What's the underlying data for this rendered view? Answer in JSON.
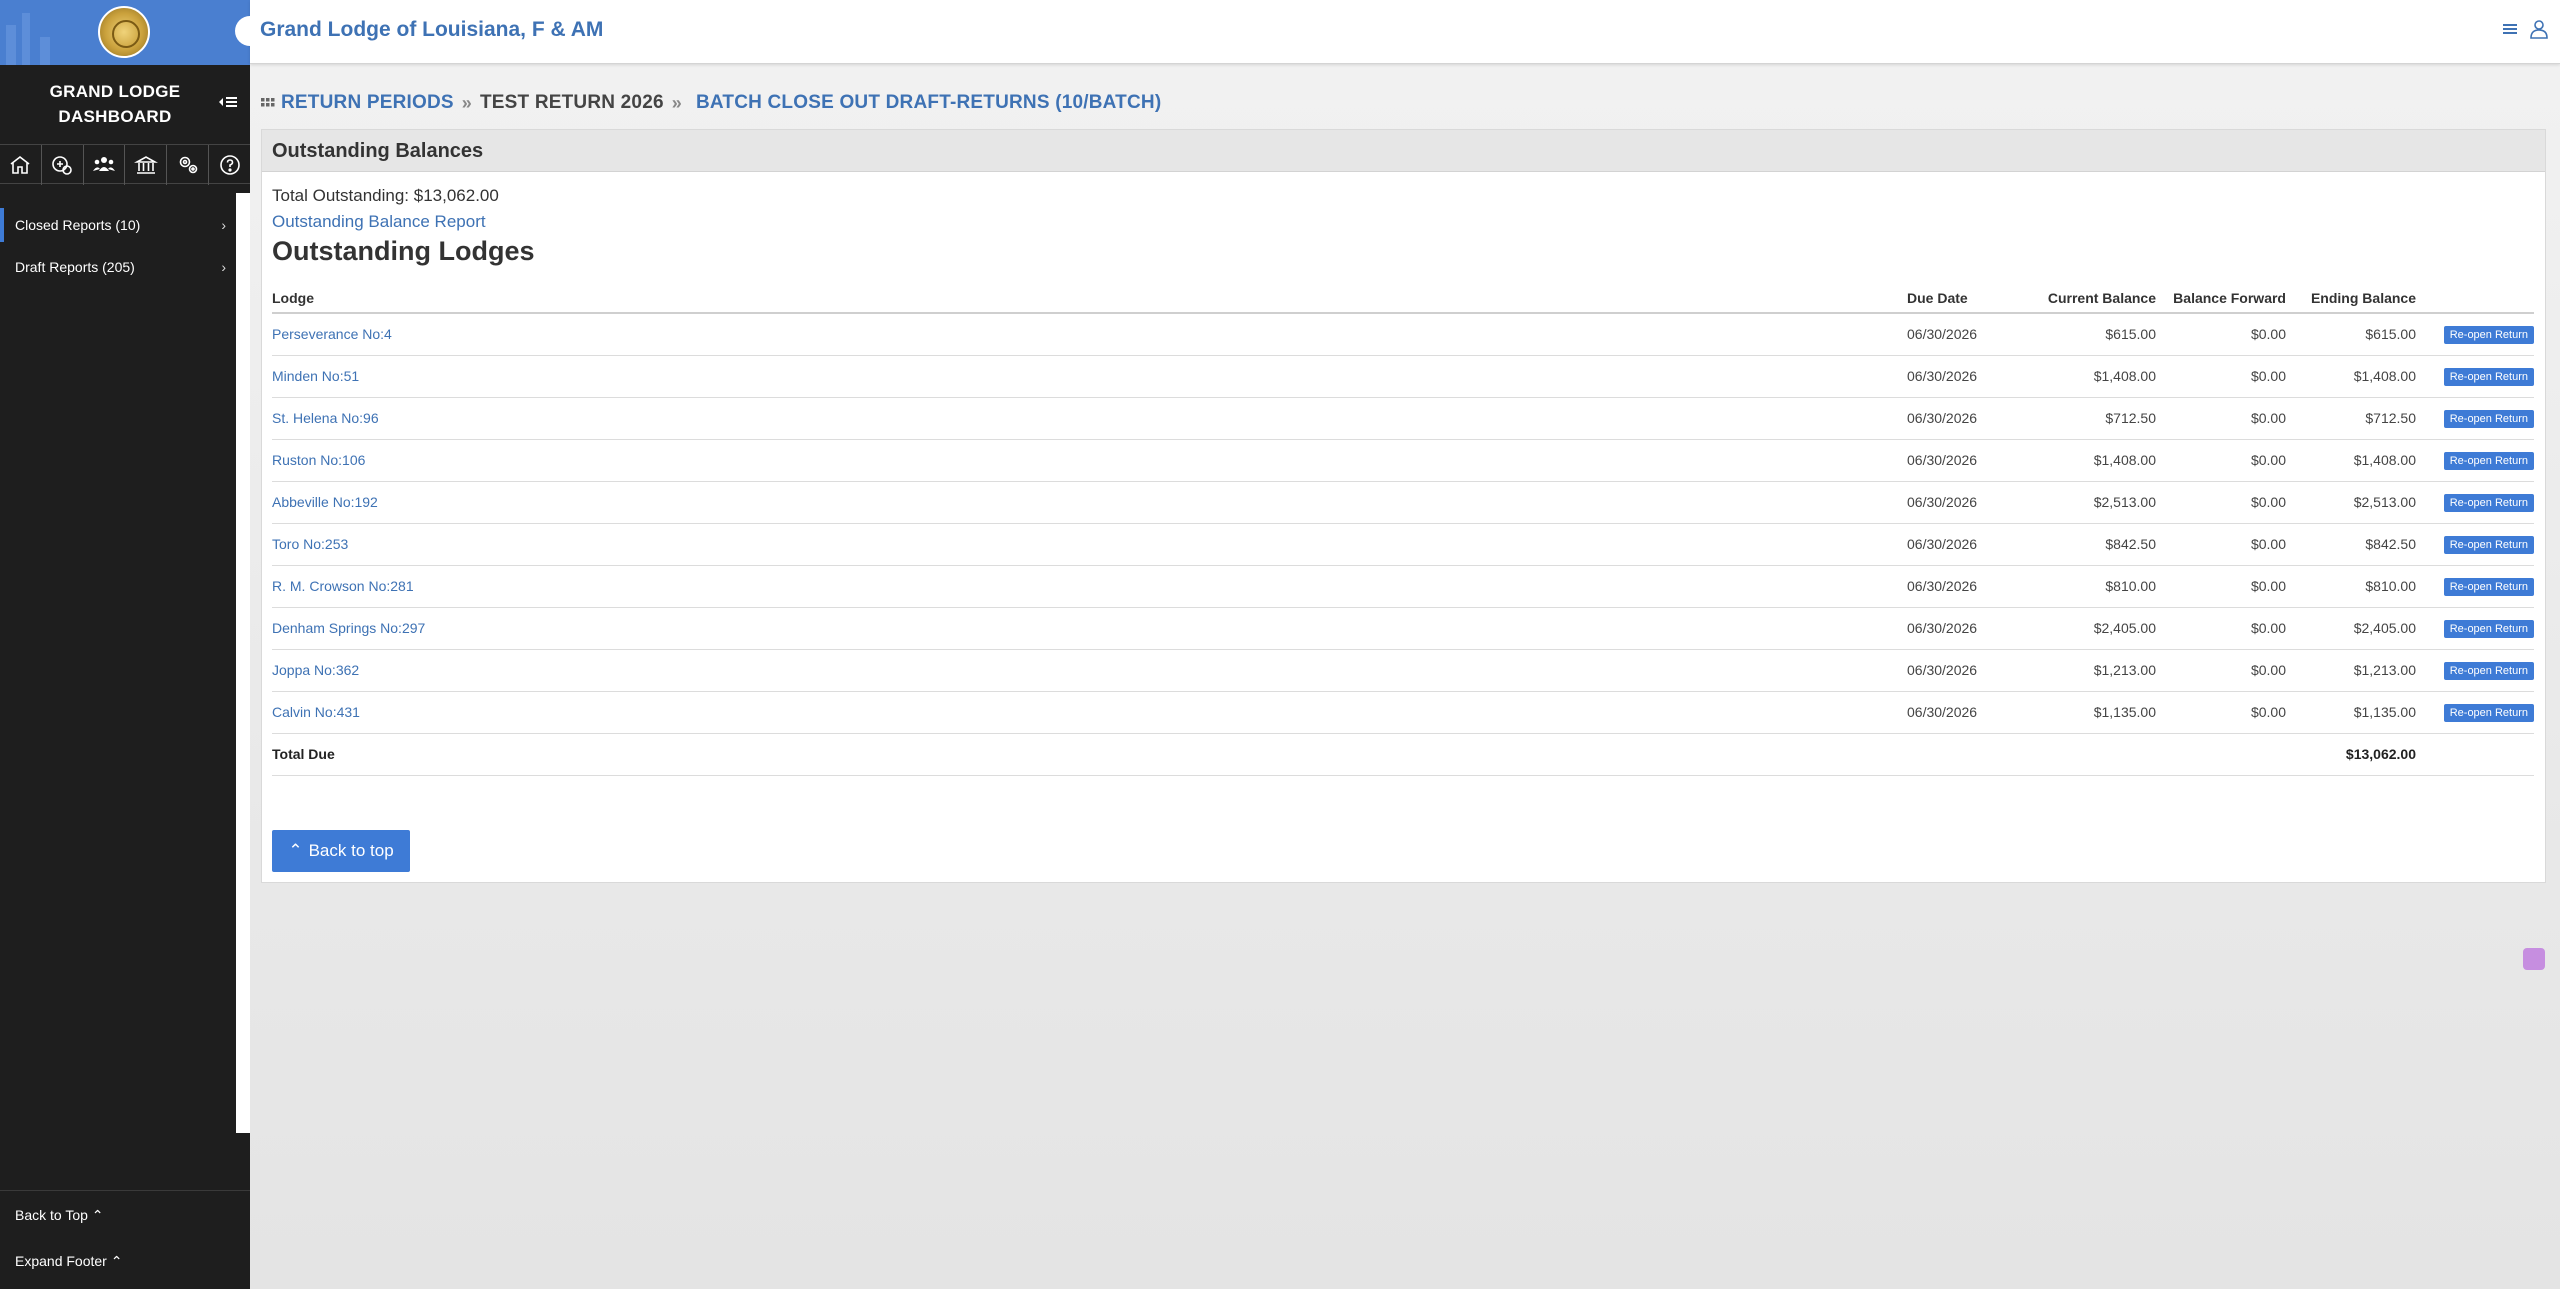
{
  "app": {
    "header_title": "Grand Lodge of Louisiana, F & AM",
    "dashboard_title_line1": "GRAND LODGE",
    "dashboard_title_line2": "DASHBOARD"
  },
  "sidebar": {
    "icons": [
      "home-icon",
      "lodge-settings-icon",
      "members-icon",
      "institution-icon",
      "settings-icon",
      "help-icon"
    ],
    "items": [
      {
        "label": "Closed Reports (10)",
        "active": true
      },
      {
        "label": "Draft Reports (205)",
        "active": false
      }
    ],
    "back_to_top": "Back to Top",
    "expand_footer": "Expand Footer"
  },
  "breadcrumb": {
    "item1": "RETURN PERIODS",
    "item2": "TEST RETURN 2026",
    "item3": "BATCH CLOSE OUT DRAFT-RETURNS (10/BATCH)"
  },
  "panel": {
    "title": "Outstanding Balances",
    "total_outstanding": "Total Outstanding: $13,062.00",
    "report_link": "Outstanding Balance Report",
    "section_title": "Outstanding Lodges",
    "columns": [
      "Lodge",
      "Due Date",
      "Current Balance",
      "Balance Forward",
      "Ending Balance"
    ],
    "rows": [
      {
        "lodge": "Perseverance No:4",
        "due": "06/30/2026",
        "current": "$615.00",
        "forward": "$0.00",
        "ending": "$615.00",
        "action": "Re-open Return"
      },
      {
        "lodge": "Minden No:51",
        "due": "06/30/2026",
        "current": "$1,408.00",
        "forward": "$0.00",
        "ending": "$1,408.00",
        "action": "Re-open Return"
      },
      {
        "lodge": "St. Helena No:96",
        "due": "06/30/2026",
        "current": "$712.50",
        "forward": "$0.00",
        "ending": "$712.50",
        "action": "Re-open Return"
      },
      {
        "lodge": "Ruston No:106",
        "due": "06/30/2026",
        "current": "$1,408.00",
        "forward": "$0.00",
        "ending": "$1,408.00",
        "action": "Re-open Return"
      },
      {
        "lodge": "Abbeville No:192",
        "due": "06/30/2026",
        "current": "$2,513.00",
        "forward": "$0.00",
        "ending": "$2,513.00",
        "action": "Re-open Return"
      },
      {
        "lodge": "Toro No:253",
        "due": "06/30/2026",
        "current": "$842.50",
        "forward": "$0.00",
        "ending": "$842.50",
        "action": "Re-open Return"
      },
      {
        "lodge": "R. M. Crowson No:281",
        "due": "06/30/2026",
        "current": "$810.00",
        "forward": "$0.00",
        "ending": "$810.00",
        "action": "Re-open Return"
      },
      {
        "lodge": "Denham Springs No:297",
        "due": "06/30/2026",
        "current": "$2,405.00",
        "forward": "$0.00",
        "ending": "$2,405.00",
        "action": "Re-open Return"
      },
      {
        "lodge": "Joppa No:362",
        "due": "06/30/2026",
        "current": "$1,213.00",
        "forward": "$0.00",
        "ending": "$1,213.00",
        "action": "Re-open Return"
      },
      {
        "lodge": "Calvin No:431",
        "due": "06/30/2026",
        "current": "$1,135.00",
        "forward": "$0.00",
        "ending": "$1,135.00",
        "action": "Re-open Return"
      }
    ],
    "total_label": "Total Due",
    "total_value": "$13,062.00",
    "back_button": "Back to top"
  },
  "colors": {
    "accent": "#3e7bd6",
    "link": "#3e72b4",
    "sidebar_bg": "#1e1e1e"
  }
}
